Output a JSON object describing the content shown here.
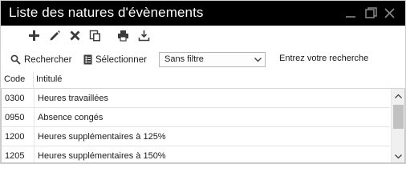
{
  "window": {
    "title": "Liste des natures d'évènements",
    "controls": [
      "minimize-icon",
      "maximize-icon",
      "close-icon"
    ]
  },
  "toolbar": {
    "buttons": [
      {
        "icon": "plus-icon",
        "action": "add"
      },
      {
        "icon": "pencil-icon",
        "action": "edit"
      },
      {
        "icon": "delete-x-icon",
        "action": "delete"
      },
      {
        "icon": "copy-icon",
        "action": "duplicate"
      },
      {
        "icon": "print-icon",
        "action": "print"
      },
      {
        "icon": "export-icon",
        "action": "export"
      }
    ]
  },
  "filterbar": {
    "search_label": "Rechercher",
    "select_label": "Sélectionner",
    "filter_value": "Sans filtre",
    "search_hint": "Entrez votre recherche"
  },
  "grid": {
    "columns": [
      "Code",
      "Intitulé"
    ],
    "rows": [
      {
        "code": "0300",
        "label": "Heures travaillées"
      },
      {
        "code": "0950",
        "label": "Absence congés"
      },
      {
        "code": "1200",
        "label": "Heures supplémentaires à 125%"
      },
      {
        "code": "1205",
        "label": "Heures supplémentaires à 150%"
      }
    ]
  },
  "colors": {
    "titlebar": "#000000",
    "title_text": "#ffffff",
    "icon_dark": "#3c3c3c",
    "scroll_thumb": "#c1c1c1"
  }
}
